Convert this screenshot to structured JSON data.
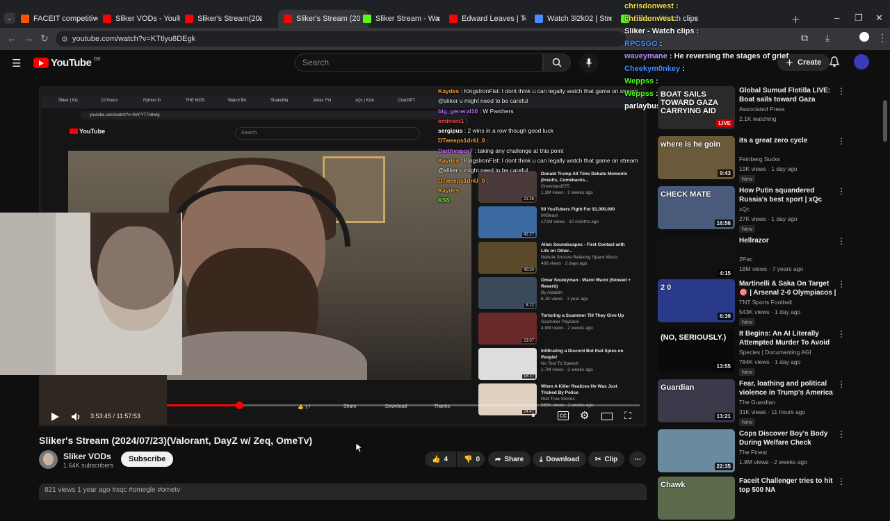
{
  "tabs": [
    {
      "label": "FACEIT competitive m",
      "color": "#ff5500"
    },
    {
      "label": "Sliker VODs - YouTub",
      "color": "#ff0000"
    },
    {
      "label": "Sliker's Stream(2024/",
      "color": "#ff0000"
    },
    {
      "label": "Sliker's Stream (2024/0",
      "color": "#ff0000",
      "active": true
    },
    {
      "label": "Sliker Stream - Watch",
      "color": "#53fc18"
    },
    {
      "label": "Edward Leaves | Thor",
      "color": "#ff0000"
    },
    {
      "label": "Watch 3l2k02 | Strea",
      "color": "#4a8cff"
    },
    {
      "label": "Sliker - Watch clips o",
      "color": "#53fc18"
    }
  ],
  "address": {
    "url": "youtube.com/watch?v=KTtlyu8DEgk"
  },
  "header": {
    "logo_text": "YouTube",
    "region": "GB",
    "search_placeholder": "Search",
    "create_label": "Create"
  },
  "overlay_chat_top": [
    {
      "user": "chrisdonwest",
      "text": "",
      "color": "#f5e050"
    },
    {
      "user": "chrisdonwest",
      "text": "",
      "color": "#f5e050"
    },
    {
      "user": "Sliker - Watch clips",
      "text": "",
      "color": "#ffffff"
    },
    {
      "user": "RPCSGO",
      "text": "",
      "color": "#4a8cff"
    },
    {
      "user": "waveymane",
      "text": "He reversing the stages of grief",
      "color": "#b892ff"
    },
    {
      "user": "Cheekym0nkey",
      "text": "",
      "color": "#4a8cff"
    },
    {
      "user": "Weppss",
      "text": "",
      "color": "#53fc18"
    },
    {
      "user": "Weppss",
      "text": "",
      "color": "#53fc18"
    },
    {
      "user": "parlaybuster",
      "text": "",
      "color": "#ffffff"
    }
  ],
  "inner_chat": [
    {
      "user": "Kaydes",
      "text": "KingsIronFist: I dont think u can legally watch that game on stream",
      "color": "#f0a030"
    },
    {
      "user": "",
      "text": "@sliker u might need to be careful",
      "color": "#ffffff"
    },
    {
      "user": "big_general10",
      "text": "W Panthers",
      "color": "#c070ff"
    },
    {
      "user": "eminent1",
      "text": "",
      "color": "#ff5050"
    },
    {
      "user": "sergipus",
      "text": "2 wins in a row though good luck",
      "color": "#ffffff"
    },
    {
      "user": "DTweeps1dnU_0",
      "text": "",
      "color": "#f0a030"
    },
    {
      "user": "Darthvapor7",
      "text": "taking any challenge at this point",
      "color": "#c070ff"
    },
    {
      "user": "Kaydes",
      "text": "KingsIronFist: I dont think u can legally watch that game on stream",
      "color": "#f0a030"
    },
    {
      "user": "",
      "text": "@sliker u might need to be careful",
      "color": "#ffffff"
    },
    {
      "user": "DTweeps1dnU_0",
      "text": "",
      "color": "#f0a030"
    },
    {
      "user": "Kaydes",
      "text": "",
      "color": "#f0a030"
    },
    {
      "user": "KS5",
      "text": "",
      "color": "#53fc18"
    }
  ],
  "inner": {
    "tabs": [
      "Sliker | Kic",
      "10 Hours",
      "Python fo",
      "THE MOS",
      "Watch Bri",
      "ShakoMa",
      "Joker: Fol",
      "xQc | Kick",
      "ChatGPT"
    ],
    "url": "youtube.com/watch?v=8mFYT7n8wtg",
    "search": "Search",
    "likes": "17",
    "share": "Share",
    "download": "Download",
    "thanks": "Thanks",
    "reco": [
      {
        "title": "Donald Trump All Time Debate Moments (Insults, Comebacks...",
        "channel": "Greenland575",
        "meta": "1.3M views · 2 weeks ago",
        "dur": "21:26",
        "color": "#4a3a3a"
      },
      {
        "title": "50 YouTubers Fight For $1,000,000",
        "channel": "MrBeast",
        "meta": "172M views · 10 months ago",
        "dur": "41:27",
        "color": "#3a6aa0"
      },
      {
        "title": "Alien Soundscapes - First Contact with Life on Other...",
        "channel": "Nebula Snooze Relaxing Space Music",
        "meta": "406 views · 3 days ago",
        "dur": "40:24",
        "color": "#5a4a2a"
      },
      {
        "title": "Omar Souleyman - Warni Warni (Slowed + Reverb)",
        "channel": "By Aladdin",
        "meta": "6.1K views · 1 year ago",
        "dur": "8:12",
        "color": "#3a4a5a"
      },
      {
        "title": "Torturing a Scammer Till They Give Up",
        "channel": "Scammer Payback",
        "meta": "4.9M views · 2 weeks ago",
        "dur": "23:07",
        "color": "#6a2a2a"
      },
      {
        "title": "Infiltrating a Discord Bot that Spies on People!",
        "channel": "No Text To Speech",
        "meta": "1.7M views · 3 weeks ago",
        "dur": "15:17",
        "color": "#dddddd"
      },
      {
        "title": "When A Killer Realizes He Was Just Tricked By Police",
        "channel": "Red Tree Stories",
        "meta": "585K views · 2 weeks ago",
        "dur": "24:47",
        "color": "#e0d0c0"
      }
    ]
  },
  "player": {
    "time": "3:53:45 / 11:57:53",
    "progress": 0.325
  },
  "video": {
    "title": "Sliker's Stream (2024/07/23)(Valorant, DayZ w/ Zeq, OmeTv)",
    "channel": "Sliker VODs",
    "subs": "1.64K subscribers",
    "subscribe": "Subscribe",
    "likes": "4",
    "dislikes": "0",
    "share": "Share",
    "download": "Download",
    "clip": "Clip",
    "desc": "821 views  1 year ago  #xqc #omegle #ometv"
  },
  "sidebar": [
    {
      "title": "Global Sumud Flotilla LIVE: Boat sails toward Gaza carrying aid",
      "channel": "Associated Press",
      "meta": "2.1K watching",
      "badge": "LIVE",
      "live": true,
      "new": false,
      "color": "#2a2a2a",
      "thumb_text": "BOAT SAILS TOWARD GAZA CARRYING AID"
    },
    {
      "title": "its a great zero cycle",
      "channel": "Feinberg Sucks",
      "meta": "19K views · 1 day ago",
      "badge": "9:43",
      "live": false,
      "new": true,
      "color": "#6a5a3a",
      "thumb_text": "where is he goin"
    },
    {
      "title": "How Putin squandered Russia's best sport | xQc Reacts",
      "channel": "xQc",
      "meta": "27K views · 1 day ago",
      "badge": "16:56",
      "live": false,
      "new": true,
      "color": "#4a5a7a",
      "thumb_text": "CHECK MATE"
    },
    {
      "title": "Hellrazor",
      "channel": "2Pac",
      "meta": "18M views · 7 years ago",
      "badge": "4:15",
      "live": false,
      "new": false,
      "color": "#111111",
      "thumb_text": ""
    },
    {
      "title": "Martinelli & Saka On Target 🎯 | Arsenal 2-0 Olympiacos | UEF...",
      "channel": "TNT Sports Football",
      "meta": "543K views · 1 day ago",
      "badge": "6:39",
      "live": false,
      "new": true,
      "color": "#2a3a8a",
      "thumb_text": "2 0"
    },
    {
      "title": "It Begins: An AI Literally Attempted Murder To Avoid ...",
      "channel": "Species | Documenting AGI",
      "meta": "784K views · 1 day ago",
      "badge": "13:55",
      "live": false,
      "new": true,
      "color": "#0a0a0a",
      "thumb_text": "(NO, SERIOUSLY.)"
    },
    {
      "title": "Fear, loathing and political violence in Trump's America | ...",
      "channel": "The Guardian",
      "meta": "31K views · 11 hours ago",
      "badge": "13:21",
      "live": false,
      "new": true,
      "color": "#3a3a4a",
      "thumb_text": "Guardian"
    },
    {
      "title": "Cops Discover Boy's Body During Welfare Check",
      "channel": "The Finest",
      "meta": "1.8M views · 2 weeks ago",
      "badge": "22:35",
      "live": false,
      "new": false,
      "color": "#6a8aa0",
      "thumb_text": ""
    },
    {
      "title": "Faceit Challenger tries to hit top 500 NA",
      "channel": "",
      "meta": "",
      "badge": "",
      "live": false,
      "new": false,
      "color": "#5a6a4a",
      "thumb_text": "Chawk"
    }
  ]
}
